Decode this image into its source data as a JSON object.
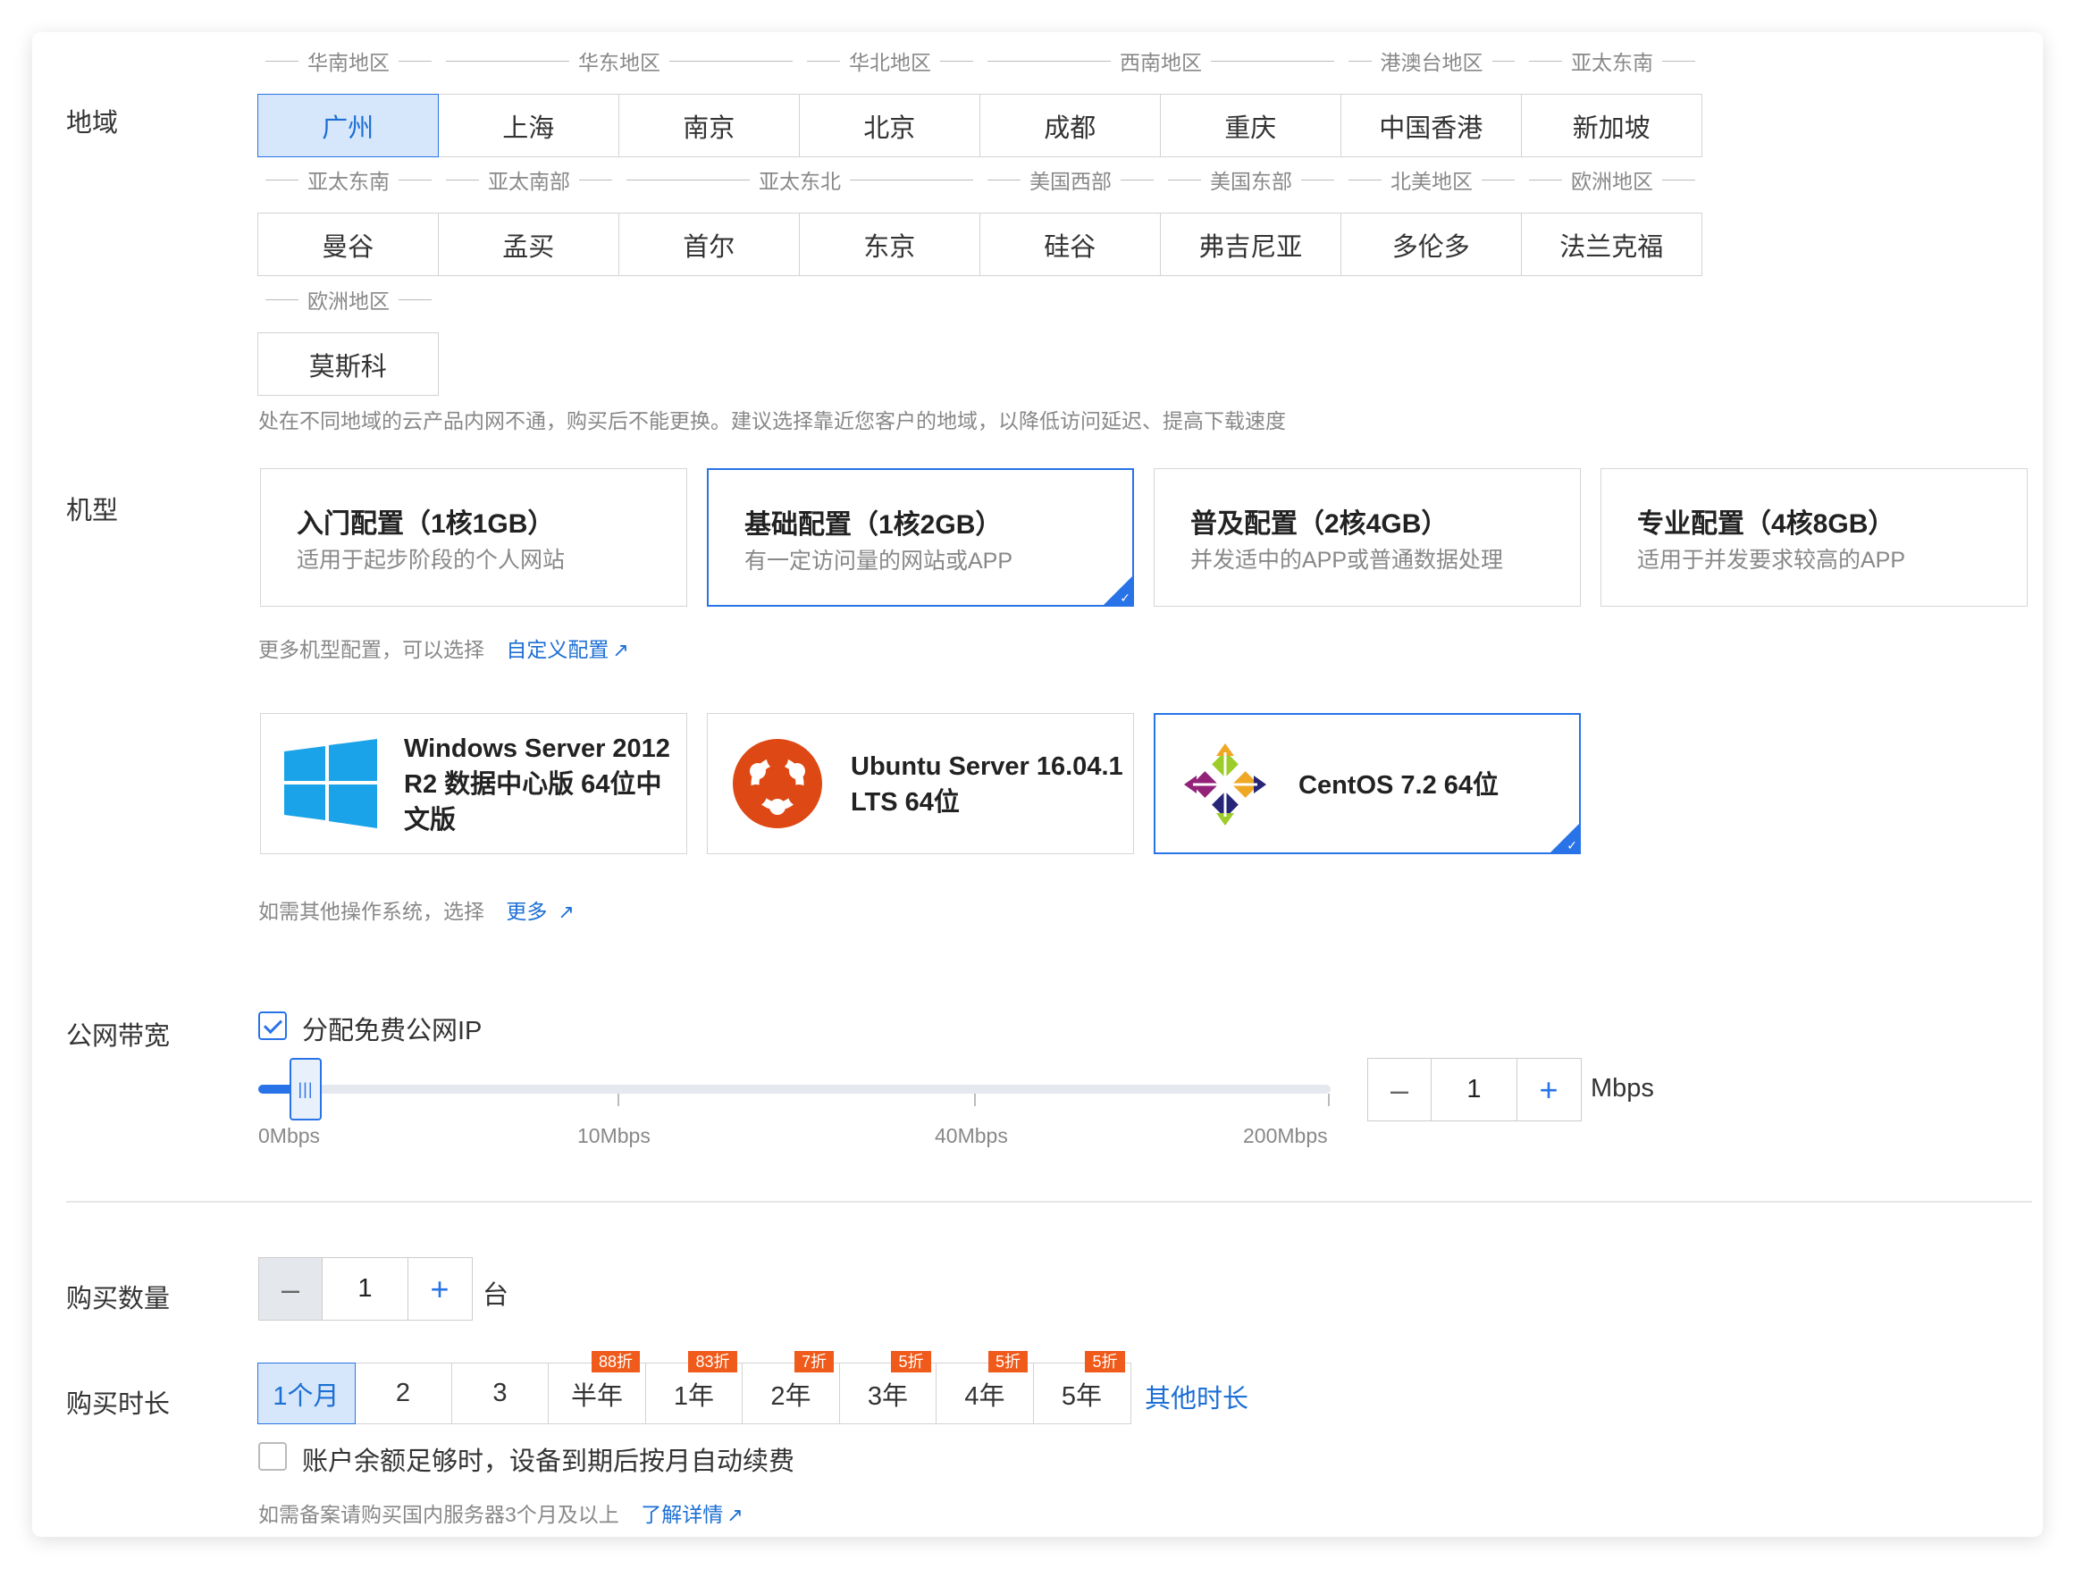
{
  "labels": {
    "region": "地域",
    "instance": "机型",
    "bandwidth": "公网带宽",
    "quantity": "购买数量",
    "duration": "购买时长"
  },
  "region_rows": [
    {
      "groups": [
        {
          "name": "华南地区",
          "span": 1
        },
        {
          "name": "华东地区",
          "span": 2
        },
        {
          "name": "华北地区",
          "span": 1
        },
        {
          "name": "西南地区",
          "span": 2
        },
        {
          "name": "港澳台地区",
          "span": 1
        },
        {
          "name": "亚太东南",
          "span": 1
        }
      ],
      "cities": [
        "广州",
        "上海",
        "南京",
        "北京",
        "成都",
        "重庆",
        "中国香港",
        "新加坡"
      ]
    },
    {
      "groups": [
        {
          "name": "亚太东南",
          "span": 1
        },
        {
          "name": "亚太南部",
          "span": 1
        },
        {
          "name": "亚太东北",
          "span": 2
        },
        {
          "name": "美国西部",
          "span": 1
        },
        {
          "name": "美国东部",
          "span": 1
        },
        {
          "name": "北美地区",
          "span": 1
        },
        {
          "name": "欧洲地区",
          "span": 1
        }
      ],
      "cities": [
        "曼谷",
        "孟买",
        "首尔",
        "东京",
        "硅谷",
        "弗吉尼亚",
        "多伦多",
        "法兰克福"
      ]
    },
    {
      "groups": [
        {
          "name": "欧洲地区",
          "span": 1
        }
      ],
      "cities": [
        "莫斯科"
      ]
    }
  ],
  "region_selected": "广州",
  "region_hint": "处在不同地域的云产品内网不通，购买后不能更换。建议选择靠近您客户的地域，以降低访问延迟、提高下载速度",
  "configs": [
    {
      "title": "入门配置（1核1GB）",
      "desc": "适用于起步阶段的个人网站"
    },
    {
      "title": "基础配置（1核2GB）",
      "desc": "有一定访问量的网站或APP"
    },
    {
      "title": "普及配置（2核4GB）",
      "desc": "并发适中的APP或普通数据处理"
    },
    {
      "title": "专业配置（4核8GB）",
      "desc": "适用于并发要求较高的APP"
    }
  ],
  "config_selected": 1,
  "config_hint": "更多机型配置，可以选择",
  "config_link": "自定义配置",
  "os": [
    {
      "lines": [
        "Windows Server 2012",
        "R2 数据中心版 64位中",
        "文版"
      ],
      "icon": "windows-logo"
    },
    {
      "lines": [
        "Ubuntu Server 16.04.1",
        "LTS 64位"
      ],
      "icon": "ubuntu-logo"
    },
    {
      "lines": [
        "CentOS 7.2 64位"
      ],
      "icon": "centos-logo"
    }
  ],
  "os_selected": 2,
  "os_hint": "如需其他操作系统，选择",
  "os_link": "更多",
  "bandwidth": {
    "free_ip_label": "分配免费公网IP",
    "free_ip_checked": true,
    "ticks": [
      "0Mbps",
      "10Mbps",
      "40Mbps",
      "200Mbps"
    ],
    "value": "1",
    "unit": "Mbps",
    "minus": "–",
    "plus": "+"
  },
  "quantity": {
    "value": "1",
    "unit": "台",
    "minus": "–",
    "plus": "+"
  },
  "durations": [
    {
      "label": "1个月",
      "tag": ""
    },
    {
      "label": "2",
      "tag": ""
    },
    {
      "label": "3",
      "tag": ""
    },
    {
      "label": "半年",
      "tag": "88折"
    },
    {
      "label": "1年",
      "tag": "83折"
    },
    {
      "label": "2年",
      "tag": "7折"
    },
    {
      "label": "3年",
      "tag": "5折"
    },
    {
      "label": "4年",
      "tag": "5折"
    },
    {
      "label": "5年",
      "tag": "5折"
    }
  ],
  "duration_selected": 0,
  "duration_other": "其他时长",
  "auto_renew": {
    "label": "账户余额足够时，设备到期后按月自动续费",
    "checked": false
  },
  "filing_hint": "如需备案请购买国内服务器3个月及以上",
  "filing_link": "了解详情",
  "colors": {
    "accent": "#2873e7",
    "discount": "#f05a1a",
    "selected_bg": "#d7e7fb"
  }
}
